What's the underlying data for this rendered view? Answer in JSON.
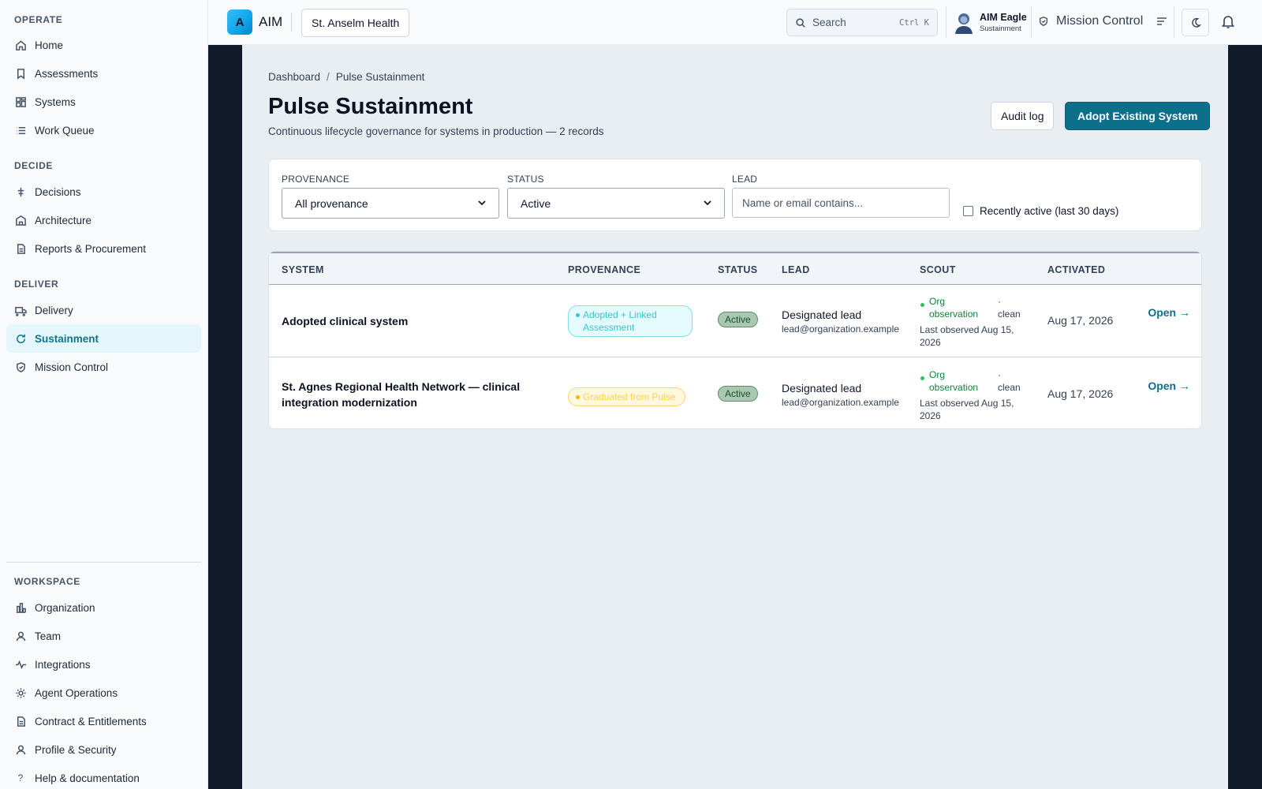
{
  "sidebar": {
    "sections": [
      {
        "title": "OPERATE",
        "items": [
          {
            "label": "Home",
            "icon": "home-icon"
          },
          {
            "label": "Assessments",
            "icon": "bookmark-icon"
          },
          {
            "label": "Systems",
            "icon": "grid-icon"
          },
          {
            "label": "Work Queue",
            "icon": "list-icon"
          }
        ]
      },
      {
        "title": "DECIDE",
        "items": [
          {
            "label": "Decisions",
            "icon": "sliders-icon"
          },
          {
            "label": "Architecture",
            "icon": "building-icon"
          },
          {
            "label": "Reports & Procurement",
            "icon": "document-icon"
          }
        ]
      },
      {
        "title": "DELIVER",
        "items": [
          {
            "label": "Delivery",
            "icon": "truck-icon"
          },
          {
            "label": "Sustainment",
            "icon": "refresh-icon",
            "active": true
          },
          {
            "label": "Mission Control",
            "icon": "shield-icon"
          }
        ]
      },
      {
        "title": "WORKSPACE",
        "items": [
          {
            "label": "Organization",
            "icon": "bar-chart-icon"
          },
          {
            "label": "Team",
            "icon": "user-icon"
          },
          {
            "label": "Integrations",
            "icon": "activity-icon"
          },
          {
            "label": "Agent Operations",
            "icon": "sun-icon"
          },
          {
            "label": "Contract & Entitlements",
            "icon": "file-icon"
          },
          {
            "label": "Profile & Security",
            "icon": "person-icon"
          },
          {
            "label": "Help & documentation",
            "icon": "help-icon"
          }
        ]
      }
    ]
  },
  "topbar": {
    "logo_letter": "A",
    "app_name": "AIM",
    "org": "St. Anselm Health",
    "search_placeholder": "Search",
    "search_shortcut": "Ctrl K",
    "user_name": "AIM Eagle",
    "user_role": "Sustainment",
    "mission_control": "Mission Control"
  },
  "page": {
    "breadcrumb": [
      "Dashboard",
      "Pulse Sustainment"
    ],
    "breadcrumb_sep": "/",
    "title": "Pulse Sustainment",
    "subtitle": "Continuous lifecycle governance for systems in production — 2 records",
    "audit_label": "Audit log",
    "adopt_label": "Adopt Existing System"
  },
  "filters": {
    "provenance_label": "PROVENANCE",
    "provenance_value": "All provenance",
    "status_label": "STATUS",
    "status_value": "Active",
    "lead_label": "LEAD",
    "lead_placeholder": "Name or email contains...",
    "recent_label": "Recently active (last 30 days)"
  },
  "table": {
    "headers": [
      "SYSTEM",
      "PROVENANCE",
      "STATUS",
      "LEAD",
      "SCOUT",
      "ACTIVATED"
    ],
    "rows": [
      {
        "system": "Adopted clinical system",
        "provenance": "Adopted + Linked Assessment",
        "status": "Active",
        "lead_name": "Designated lead",
        "lead_email": "lead@organization.example",
        "scout_obs": "Org observation",
        "scout_sep": "·",
        "scout_clean": "clean",
        "scout_last": "Last observed Aug 15, 2026",
        "activated": "Aug 17, 2026",
        "open": "Open →"
      },
      {
        "system": "St. Agnes Regional Health Network — clinical integration modernization",
        "provenance": "Graduated from Pulse",
        "status": "Active",
        "lead_name": "Designated lead",
        "lead_email": "lead@organization.example",
        "scout_obs": "Org observation",
        "scout_sep": "·",
        "scout_clean": "clean",
        "scout_last": "Last observed Aug 15, 2026",
        "activated": "Aug 17, 2026",
        "open": "Open →"
      }
    ]
  },
  "colors": {
    "accent": "#0e6f8a",
    "active_nav": "#e6f7fb",
    "status_green": "#22c55e"
  }
}
